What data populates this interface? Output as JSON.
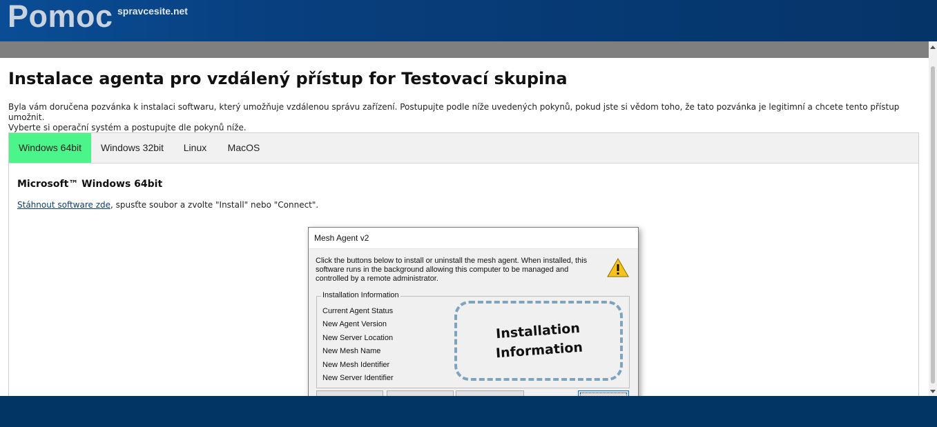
{
  "header": {
    "logo": "Pomoc",
    "site": "spravcesite.net",
    "colors": {
      "header_bg": "#0a4d96",
      "footer_bg": "#033564",
      "active_tab": "#4bf58a",
      "bar": "#7f7f7f"
    }
  },
  "page": {
    "title": "Instalace agenta pro vzdálený přístup for Testovací skupina",
    "intro_line1": "Byla vám doručena pozvánka k instalaci softwaru, který umožňuje vzdálenou správu zařízení. Postupujte podle níže uvedených pokynů, pokud jste si vědom toho, že tato pozvánka je legitimní a chcete tento přístup umožnit.",
    "intro_line2": "Vyberte si operační systém a postupujte dle pokynů níže."
  },
  "tabs": [
    {
      "label": "Windows 64bit",
      "active": true
    },
    {
      "label": "Windows 32bit",
      "active": false
    },
    {
      "label": "Linux",
      "active": false
    },
    {
      "label": "MacOS",
      "active": false
    }
  ],
  "panel": {
    "heading": "Microsoft™ Windows 64bit",
    "download_link": "Stáhnout software zde",
    "download_rest": ", spusťte soubor a zvolte \"Install\" nebo \"Connect\"."
  },
  "dialog": {
    "title": "Mesh Agent v2",
    "description": "Click the buttons below to install or uninstall the mesh agent. When installed, this software runs in the background allowing this computer to be managed and controlled by a remote administrator.",
    "warning_icon": "warning-icon",
    "group_label": "Installation Information",
    "rows": [
      "Current Agent Status",
      "New Agent Version",
      "New Server Location",
      "New Mesh Name",
      "New Mesh Identifier",
      "New Server Identifier"
    ],
    "callout_line1": "Installation",
    "callout_line2": "Information"
  }
}
